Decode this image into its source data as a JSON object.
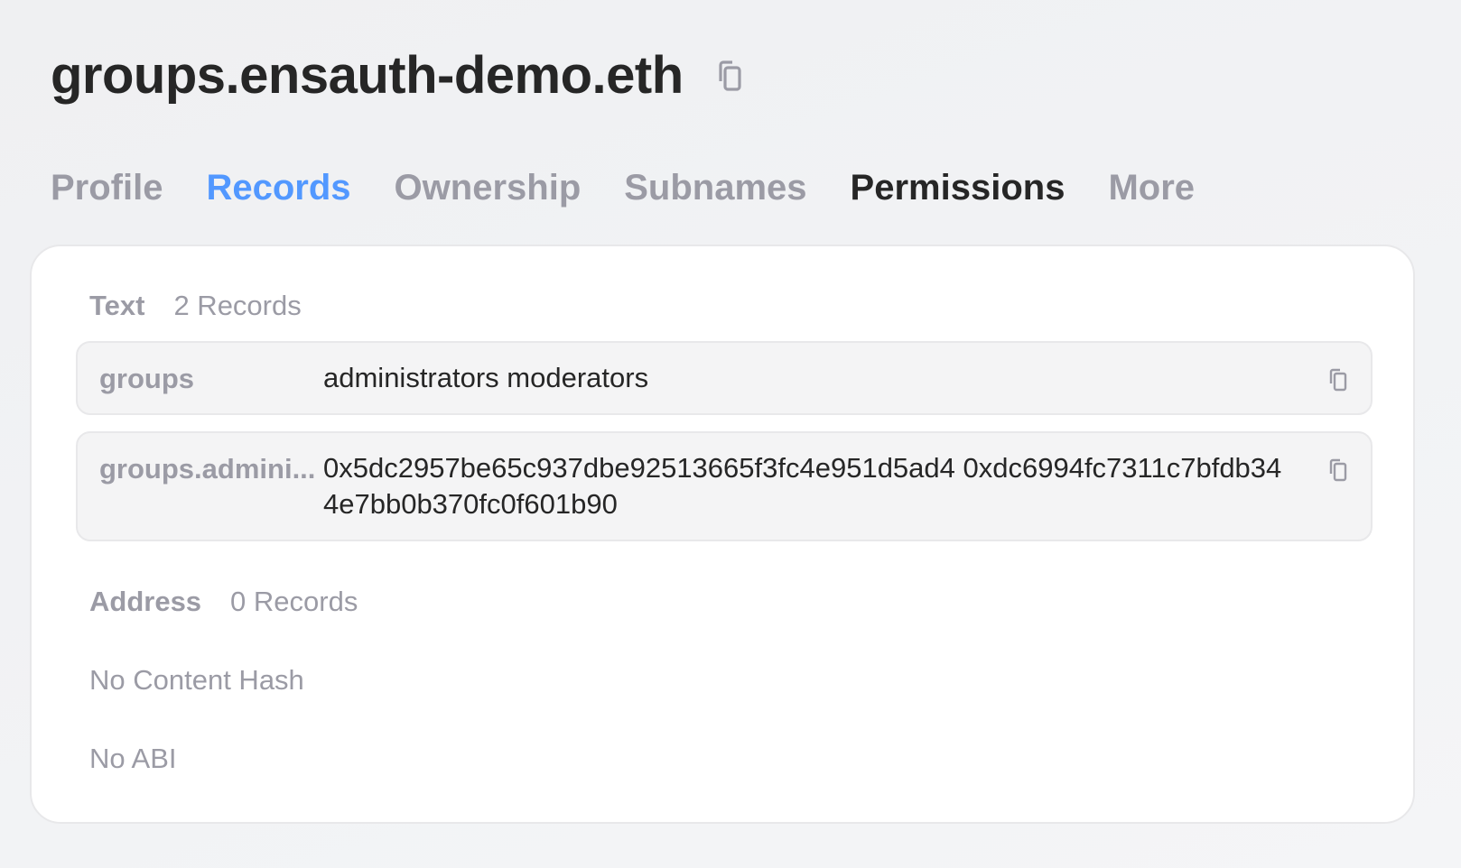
{
  "header": {
    "title": "groups.ensauth-demo.eth",
    "copy_icon": "copy-icon"
  },
  "tabs": [
    {
      "label": "Profile",
      "state": "inactive"
    },
    {
      "label": "Records",
      "state": "active"
    },
    {
      "label": "Ownership",
      "state": "inactive"
    },
    {
      "label": "Subnames",
      "state": "inactive"
    },
    {
      "label": "Permissions",
      "state": "emphasized"
    },
    {
      "label": "More",
      "state": "inactive"
    }
  ],
  "records": {
    "text": {
      "title": "Text",
      "count": "2 Records",
      "items": [
        {
          "key": "groups",
          "value": "administrators moderators"
        },
        {
          "key": "groups.admini...",
          "value": "0x5dc2957be65c937dbe92513665f3fc4e951d5ad4 0xdc6994fc7311c7bfdb344e7bb0b370fc0f601b90"
        }
      ]
    },
    "address": {
      "title": "Address",
      "count": "0 Records"
    },
    "content_hash": "No Content Hash",
    "abi": "No ABI"
  },
  "colors": {
    "accent": "#5298ff",
    "muted": "#9b9ba5",
    "text": "#262626",
    "row_bg": "#f4f4f5"
  }
}
